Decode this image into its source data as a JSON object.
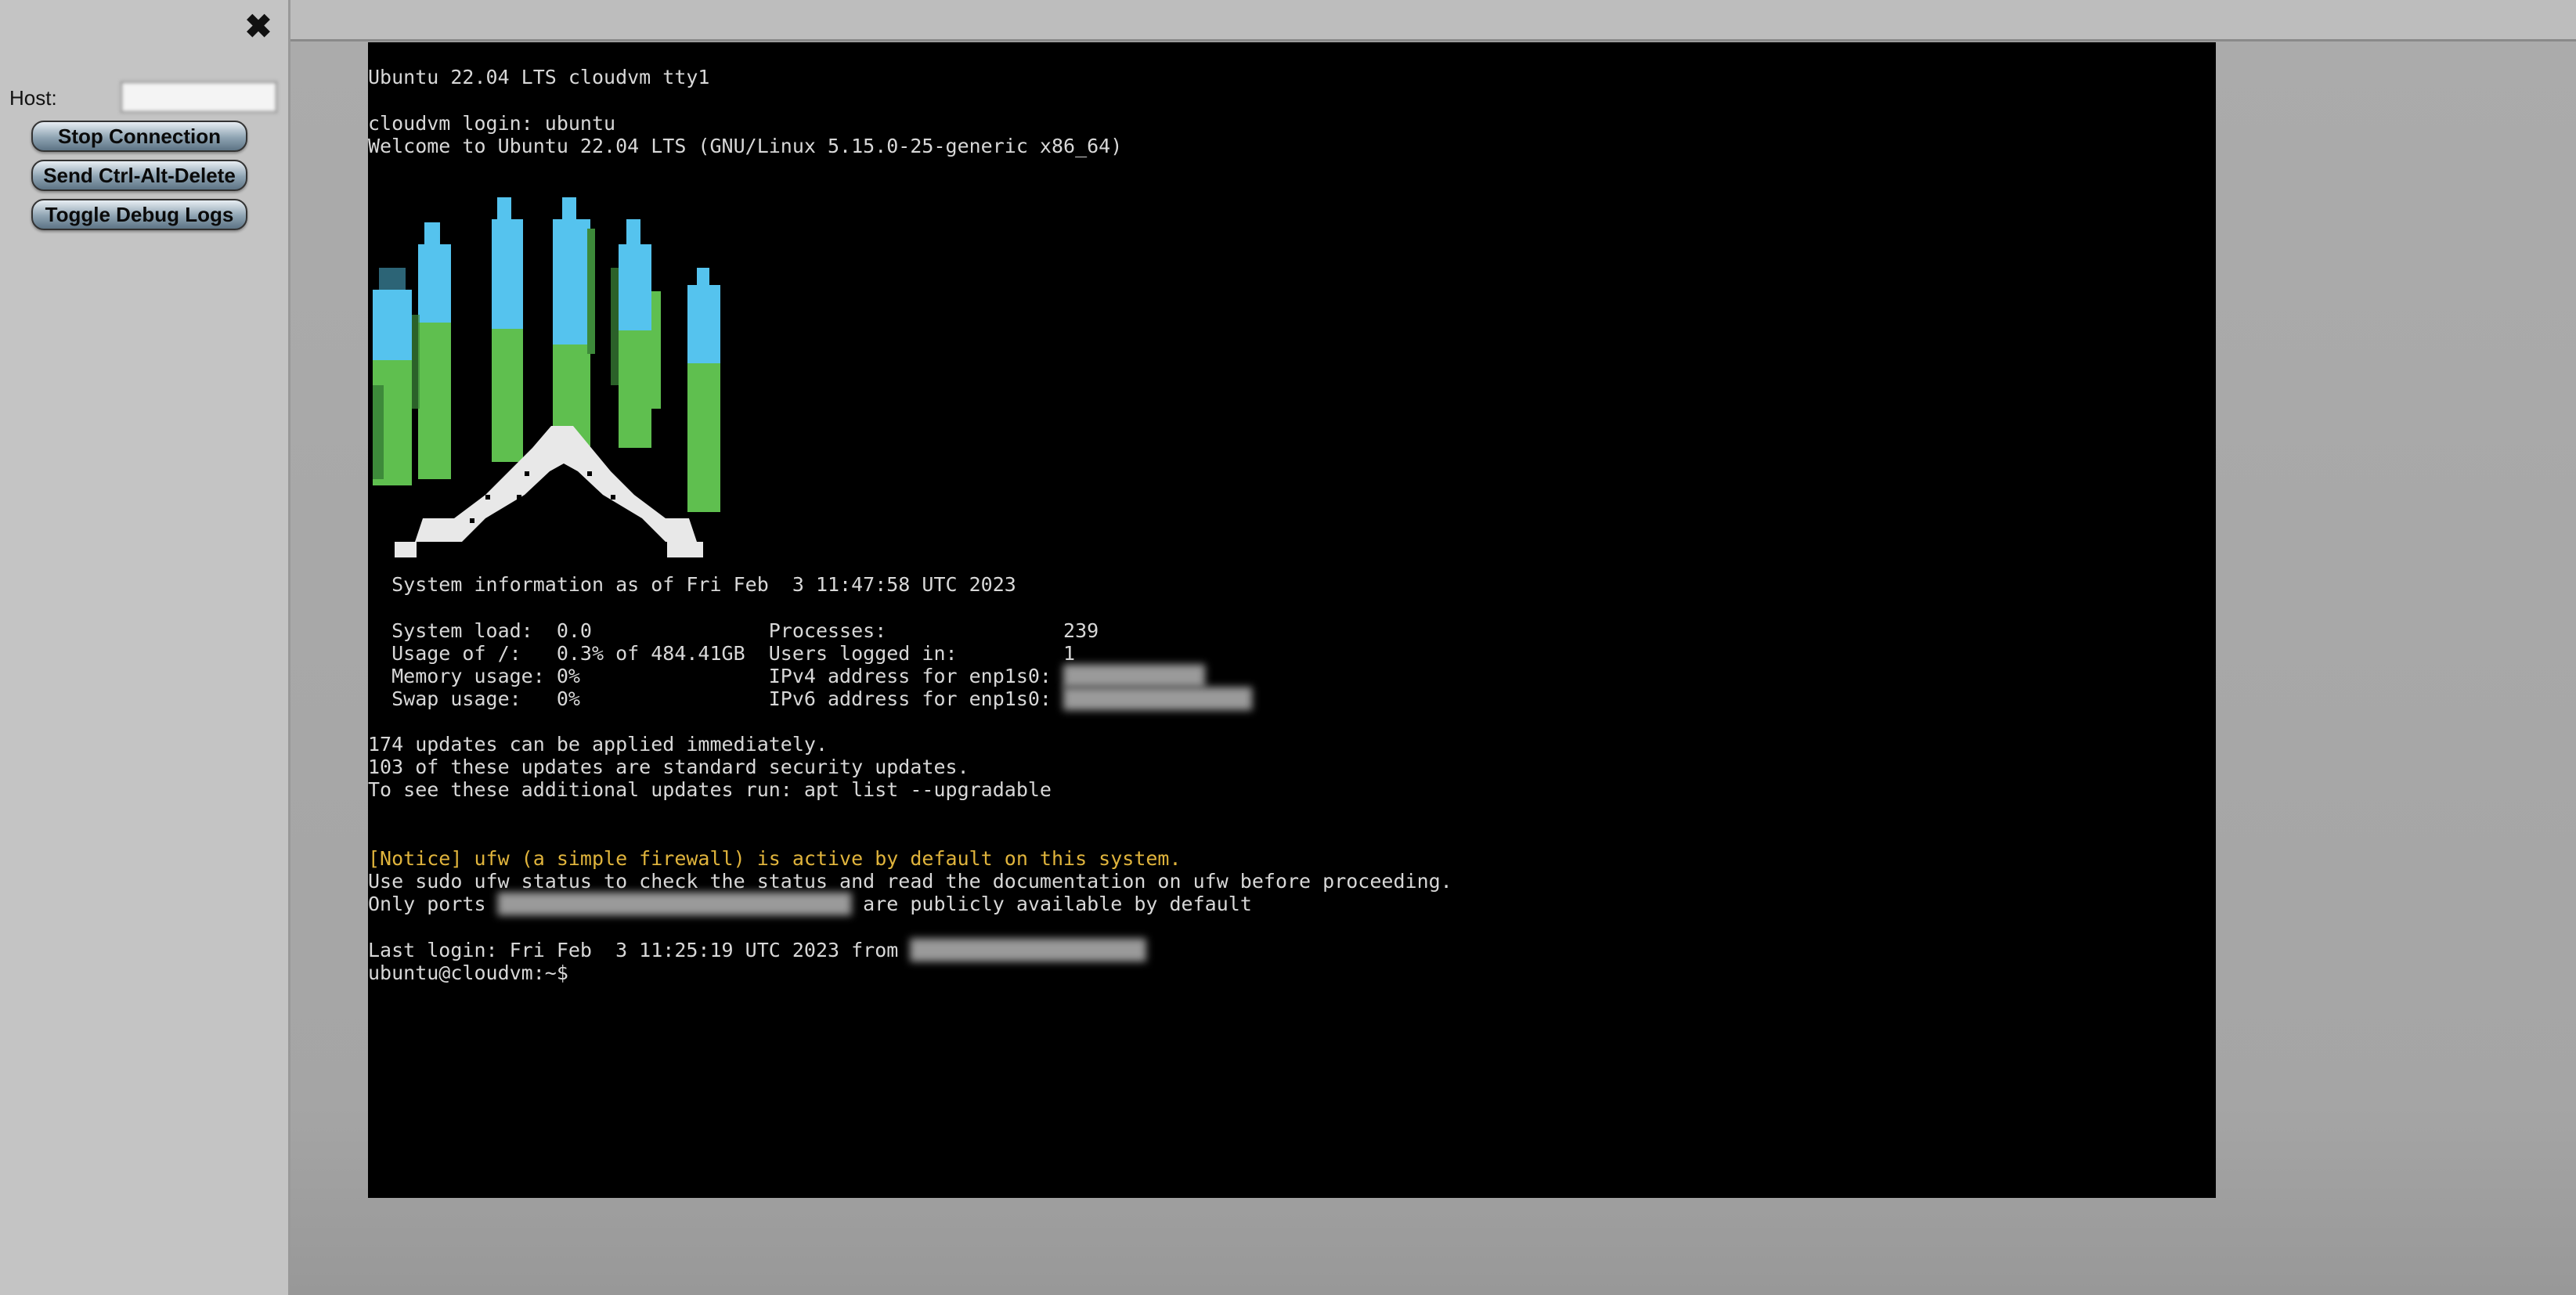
{
  "sidebar": {
    "close_icon": "close-icon",
    "host_label": "Host:",
    "host_value": "",
    "buttons": {
      "stop": "Stop Connection",
      "ctrl_alt_delete": "Send Ctrl-Alt-Delete",
      "debug": "Toggle Debug Logs"
    }
  },
  "terminal": {
    "lines": {
      "header": "Ubuntu 22.04 LTS cloudvm tty1",
      "login": "cloudvm login: ubuntu",
      "welcome": "Welcome to Ubuntu 22.04 LTS (GNU/Linux 5.15.0-25-generic x86_64)",
      "sysinfo": "  System information as of Fri Feb  3 11:47:58 UTC 2023",
      "load": "  System load:  0.0               Processes:               239",
      "usage": "  Usage of /:   0.3% of 484.41GB  Users logged in:         1",
      "memory_prefix": "  Memory usage: 0%                IPv4 address for enp1s0: ",
      "swap_prefix": "  Swap usage:   0%                IPv6 address for enp1s0: ",
      "updates1": "174 updates can be applied immediately.",
      "updates2": "103 of these updates are standard security updates.",
      "updates3": "To see these additional updates run: apt list --upgradable",
      "notice": "[Notice] ufw (a simple firewall) is active by default on this system.",
      "ufw": "Use sudo ufw status to check the status and read the documentation on ufw before proceeding.",
      "ports_prefix": "Only ports ",
      "ports_suffix": " are publicly available by default",
      "lastlogin_prefix": "Last login: Fri Feb  3 11:25:19 UTC 2023 from ",
      "prompt": "ubuntu@cloudvm:~$"
    },
    "colors": {
      "background": "#000000",
      "text": "#d8d8d8",
      "notice": "#e0b43c",
      "logo_blue": "#55c3ee",
      "logo_green": "#5fbf4f",
      "logo_white": "#e8e8e8"
    }
  }
}
